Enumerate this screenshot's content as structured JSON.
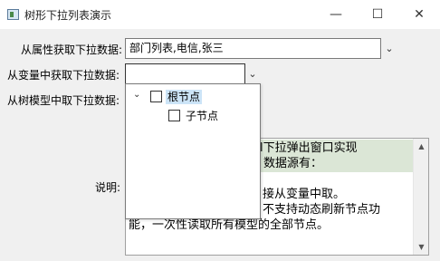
{
  "window": {
    "title": "树形下拉列表演示",
    "minimize_glyph": "—",
    "maximize_glyph": "☐",
    "close_glyph": "✕"
  },
  "form": {
    "row1_label": "从属性获取下拉数据:",
    "row1_value": "部门列表,电信,张三",
    "row2_label": "从变量中获取下拉数据:",
    "row2_value": "",
    "row3_label": "从树模型中取下拉数据:",
    "desc_label": "说明:"
  },
  "description": {
    "visible_lines": [
      "l下拉弹出窗口实现",
      "数据源有：",
      "接从变量中取。",
      "不支持动态刷新节点功",
      "能，一次性读取所有模型的全部节点。"
    ]
  },
  "tree_popup": {
    "root_label": "根节点",
    "child_label": "子节点"
  },
  "icons": {
    "chevron": "⌄",
    "expander": "⌄",
    "scroll_up": "▲",
    "scroll_down": "▼"
  },
  "colors": {
    "selection": "#cce4f7",
    "highlight_line": "#dbe6d6"
  }
}
